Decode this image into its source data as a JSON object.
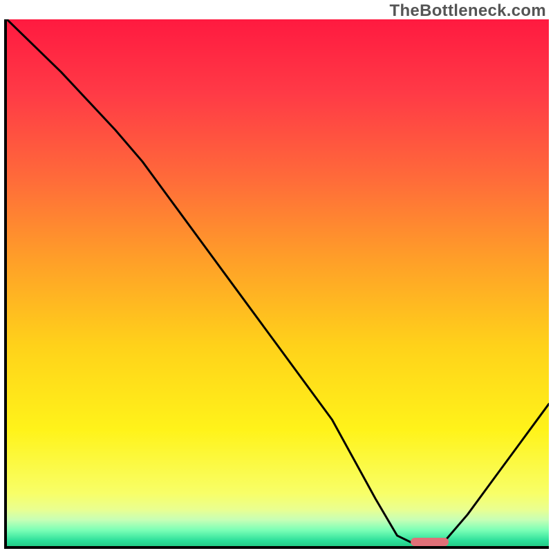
{
  "watermark": "TheBottleneck.com",
  "chart_data": {
    "type": "line",
    "title": "",
    "xlabel": "",
    "ylabel": "",
    "x": [
      0.0,
      0.1,
      0.2,
      0.25,
      0.3,
      0.4,
      0.5,
      0.6,
      0.68,
      0.72,
      0.76,
      0.8,
      0.85,
      0.9,
      0.95,
      1.0
    ],
    "values": [
      1.0,
      0.9,
      0.79,
      0.73,
      0.66,
      0.52,
      0.38,
      0.24,
      0.09,
      0.02,
      0.0,
      0.0,
      0.06,
      0.13,
      0.2,
      0.27
    ],
    "xlim": [
      0,
      1
    ],
    "ylim": [
      0,
      1
    ],
    "marker": {
      "x0": 0.745,
      "x1": 0.815,
      "y": 0.0,
      "color": "#e07078"
    },
    "background_gradient": [
      "#ff1a40",
      "#ff6a3a",
      "#ffd21a",
      "#fff31a",
      "#2cdf9a",
      "#24cc86"
    ]
  }
}
